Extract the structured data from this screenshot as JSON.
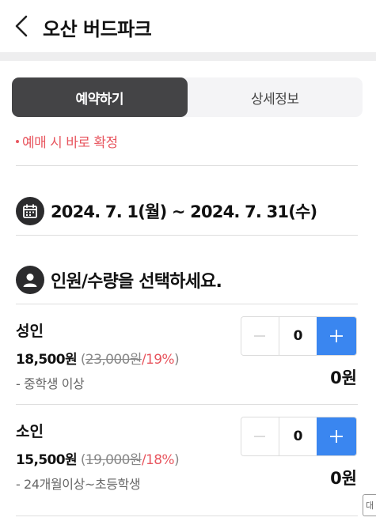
{
  "header": {
    "title": "오산 버드파크",
    "back_icon": "chevron-left-icon"
  },
  "tabs": [
    {
      "label": "예약하기",
      "active": true
    },
    {
      "label": "상세정보",
      "active": false
    }
  ],
  "notice": "예매 시 바로 확정",
  "date_section": {
    "icon": "calendar-icon",
    "text": "2024. 7. 1(월) ~ 2024. 7. 31(수)"
  },
  "people_section": {
    "icon": "person-icon",
    "text": "인원/수량을 선택하세요."
  },
  "tickets": [
    {
      "name": "성인",
      "sale_price": "18,500원",
      "open_paren": "(",
      "original_price": "23,000원",
      "slash": "/",
      "discount": "19%",
      "close_paren": ")",
      "description": "- 중학생 이상",
      "quantity": "0",
      "subtotal": "0원"
    },
    {
      "name": "소인",
      "sale_price": "15,500원",
      "open_paren": "(",
      "original_price": "19,000원",
      "slash": "/",
      "discount": "18%",
      "close_paren": ")",
      "description": "- 24개월이상~초등학생",
      "quantity": "0",
      "subtotal": "0원"
    }
  ],
  "side_tab_label": "대",
  "colors": {
    "accent": "#3a86f0",
    "notice": "#e8565f",
    "active_tab": "#444446"
  }
}
